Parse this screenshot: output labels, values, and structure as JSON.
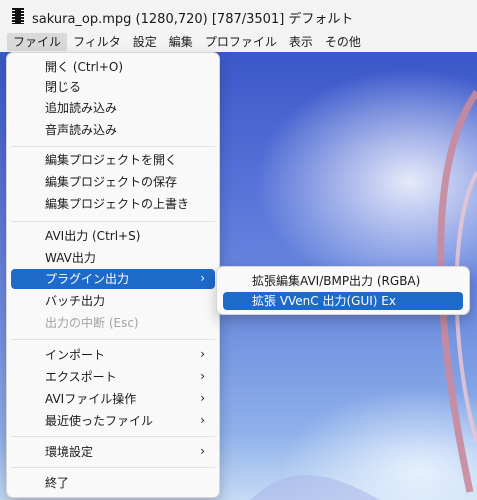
{
  "window": {
    "title": "sakura_op.mpg (1280,720)  [787/3501]  デフォルト",
    "icon": "film-strip-icon"
  },
  "menubar": {
    "items": [
      "ファイル",
      "フィルタ",
      "設定",
      "編集",
      "プロファイル",
      "表示",
      "その他"
    ],
    "active_index": 0
  },
  "file_menu": {
    "items": [
      {
        "label": "開く (Ctrl+O)"
      },
      {
        "label": "閉じる"
      },
      {
        "label": "追加読み込み"
      },
      {
        "label": "音声読み込み"
      },
      {
        "label": "編集プロジェクトを開く"
      },
      {
        "label": "編集プロジェクトの保存"
      },
      {
        "label": "編集プロジェクトの上書き"
      },
      {
        "label": "AVI出力 (Ctrl+S)"
      },
      {
        "label": "WAV出力"
      },
      {
        "label": "プラグイン出力",
        "submenu": true,
        "state": "highlighted"
      },
      {
        "label": "バッチ出力"
      },
      {
        "label": "出力の中断 (Esc)",
        "state": "disabled"
      },
      {
        "label": "インポート",
        "submenu": true
      },
      {
        "label": "エクスポート",
        "submenu": true
      },
      {
        "label": "AVIファイル操作",
        "submenu": true
      },
      {
        "label": "最近使ったファイル",
        "submenu": true
      },
      {
        "label": "環境設定",
        "submenu": true
      },
      {
        "label": "終了"
      }
    ],
    "submenu_arrow": "›"
  },
  "plugin_submenu": {
    "items": [
      {
        "label": "拡張編集AVI/BMP出力 (RGBA)"
      },
      {
        "label": "拡張 VVenC 出力(GUI) Ex",
        "state": "highlighted"
      }
    ]
  },
  "colors": {
    "highlight": "#1e6ac9",
    "menu_background": "#f9f9f9",
    "disabled_text": "#a3a3a3"
  }
}
